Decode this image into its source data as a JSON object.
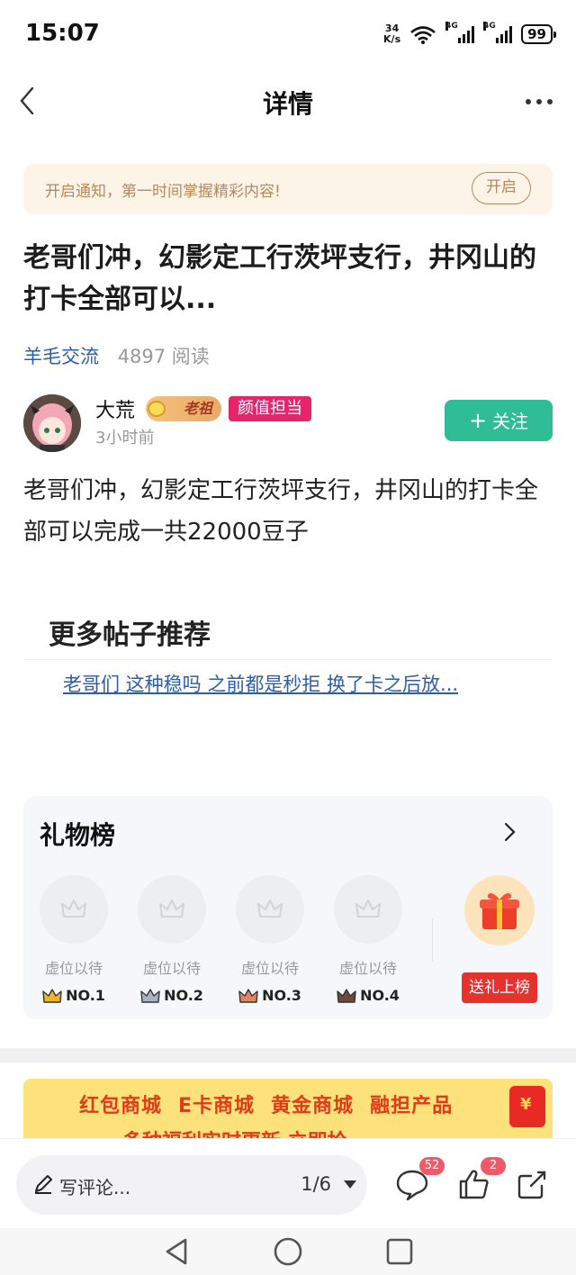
{
  "status_bar": {
    "time": "15:07",
    "net_speed_value": "34",
    "net_speed_unit": "K/s",
    "signal_label_1": "4G",
    "signal_label_2": "4G",
    "battery": "99"
  },
  "nav": {
    "title": "详情",
    "back_icon": "chevron-left-icon",
    "more_icon": "more-dots-icon"
  },
  "notify": {
    "text": "开启通知，第一时间掌握精彩内容!",
    "button": "开启"
  },
  "post": {
    "title": "老哥们冲，幻影定工行茨坪支行，井冈山的打卡全部可以...",
    "category": "羊毛交流",
    "read_count": "4897 阅读",
    "body": "老哥们冲，幻影定工行茨坪支行，井冈山的打卡全部可以完成一共22000豆子"
  },
  "author": {
    "name": "大荒",
    "badge_laozu": "老祖",
    "badge_title": "颜值担当",
    "time": "3小时前",
    "follow_label": "关注",
    "follow_icon": "+"
  },
  "more_posts": {
    "heading": "更多帖子推荐",
    "items": [
      "老哥们 这种稳吗 之前都是秒拒 换了卡之后放..."
    ]
  },
  "gift_board": {
    "title": "礼物榜",
    "slots": [
      {
        "label": "虚位以待",
        "rank": "NO.1",
        "crown_color": "#f2b51c"
      },
      {
        "label": "虚位以待",
        "rank": "NO.2",
        "crown_color": "#a7b4c6"
      },
      {
        "label": "虚位以待",
        "rank": "NO.3",
        "crown_color": "#e3855a"
      },
      {
        "label": "虚位以待",
        "rank": "NO.4",
        "crown_color": "#6b4a3c"
      }
    ],
    "send_label": "送礼上榜"
  },
  "ad": {
    "items": [
      "红包商城",
      "E卡商城",
      "黄金商城",
      "融担产品"
    ],
    "row2": "多种福利实时更新 立即抢"
  },
  "bottom_bar": {
    "comment_placeholder": "写评论...",
    "page_indicator": "1/6",
    "comment_count": "52",
    "like_count": "2"
  },
  "colors": {
    "accent_green": "#2fbd96",
    "link_blue": "#2a5db0",
    "badge_pink": "#e6246a",
    "send_red": "#e5322d"
  }
}
